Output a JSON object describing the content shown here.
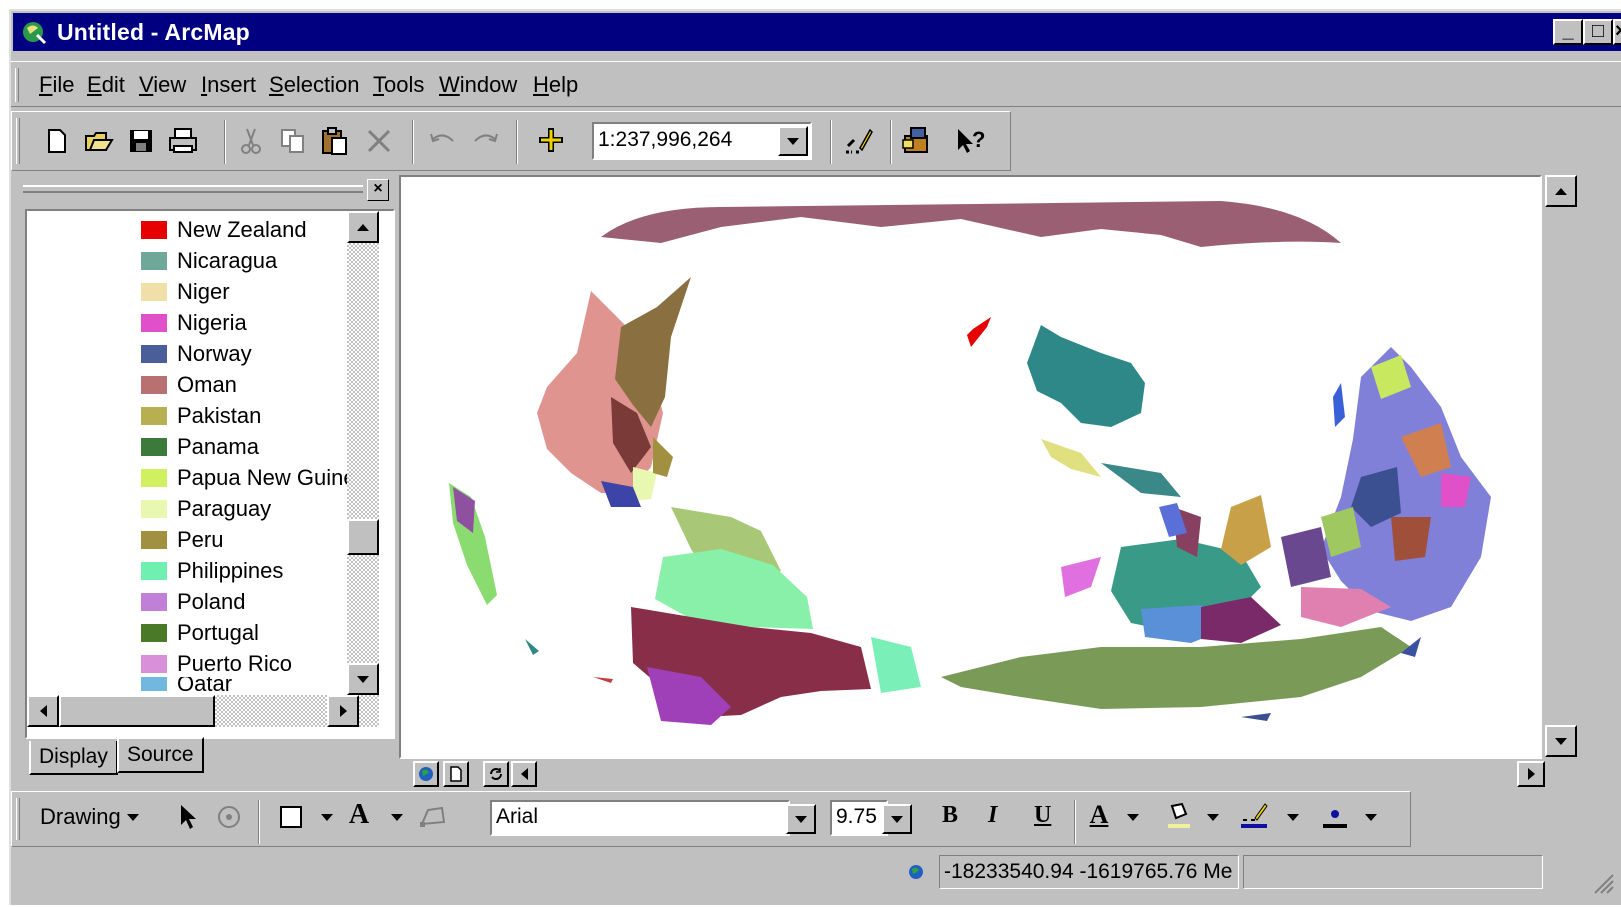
{
  "window": {
    "title": "Untitled - ArcMap",
    "min_label": "_",
    "max_label": "□",
    "close_label": "×"
  },
  "menu": [
    {
      "label": "File",
      "key": "F",
      "rest": "ile"
    },
    {
      "label": "Edit",
      "key": "E",
      "rest": "dit"
    },
    {
      "label": "View",
      "key": "V",
      "rest": "iew"
    },
    {
      "label": "Insert",
      "key": "I",
      "rest": "nsert"
    },
    {
      "label": "Selection",
      "key": "S",
      "rest": "election"
    },
    {
      "label": "Tools",
      "key": "T",
      "rest": "ools"
    },
    {
      "label": "Window",
      "key": "W",
      "rest": "indow"
    },
    {
      "label": "Help",
      "key": "H",
      "rest": "elp"
    }
  ],
  "toolbar": {
    "scale": "1:237,996,264",
    "icons": [
      "new-icon",
      "open-icon",
      "save-icon",
      "print-icon",
      "cut-icon",
      "copy-icon",
      "paste-icon",
      "delete-icon",
      "undo-icon",
      "redo-icon",
      "add-data-icon",
      "editor-icon",
      "arctoolbox-icon",
      "whats-this-icon"
    ]
  },
  "toc": {
    "items": [
      {
        "label": "New Zealand",
        "color": "#e60000"
      },
      {
        "label": "Nicaragua",
        "color": "#6fa898"
      },
      {
        "label": "Niger",
        "color": "#f0e0a8"
      },
      {
        "label": "Nigeria",
        "color": "#e050c8"
      },
      {
        "label": "Norway",
        "color": "#4a5f9a"
      },
      {
        "label": "Oman",
        "color": "#b87070"
      },
      {
        "label": "Pakistan",
        "color": "#b8b050"
      },
      {
        "label": "Panama",
        "color": "#3c7a3c"
      },
      {
        "label": "Papua New Guine",
        "color": "#d0f060"
      },
      {
        "label": "Paraguay",
        "color": "#e8f8b0"
      },
      {
        "label": "Peru",
        "color": "#a09040"
      },
      {
        "label": "Philippines",
        "color": "#70f0b0"
      },
      {
        "label": "Poland",
        "color": "#c080d8"
      },
      {
        "label": "Portugal",
        "color": "#4a7a28"
      },
      {
        "label": "Puerto Rico",
        "color": "#d890d8"
      },
      {
        "label": "Qatar",
        "color": "#70b8e0"
      }
    ],
    "tabs": {
      "display": "Display",
      "source": "Source"
    }
  },
  "drawing": {
    "label": "Drawing",
    "font": "Arial",
    "size": "9.75",
    "bold": "B",
    "italic": "I",
    "underline": "U",
    "font_color_letter": "A"
  },
  "status": {
    "coords": "-18233540.94  -1619765.76 Me"
  }
}
